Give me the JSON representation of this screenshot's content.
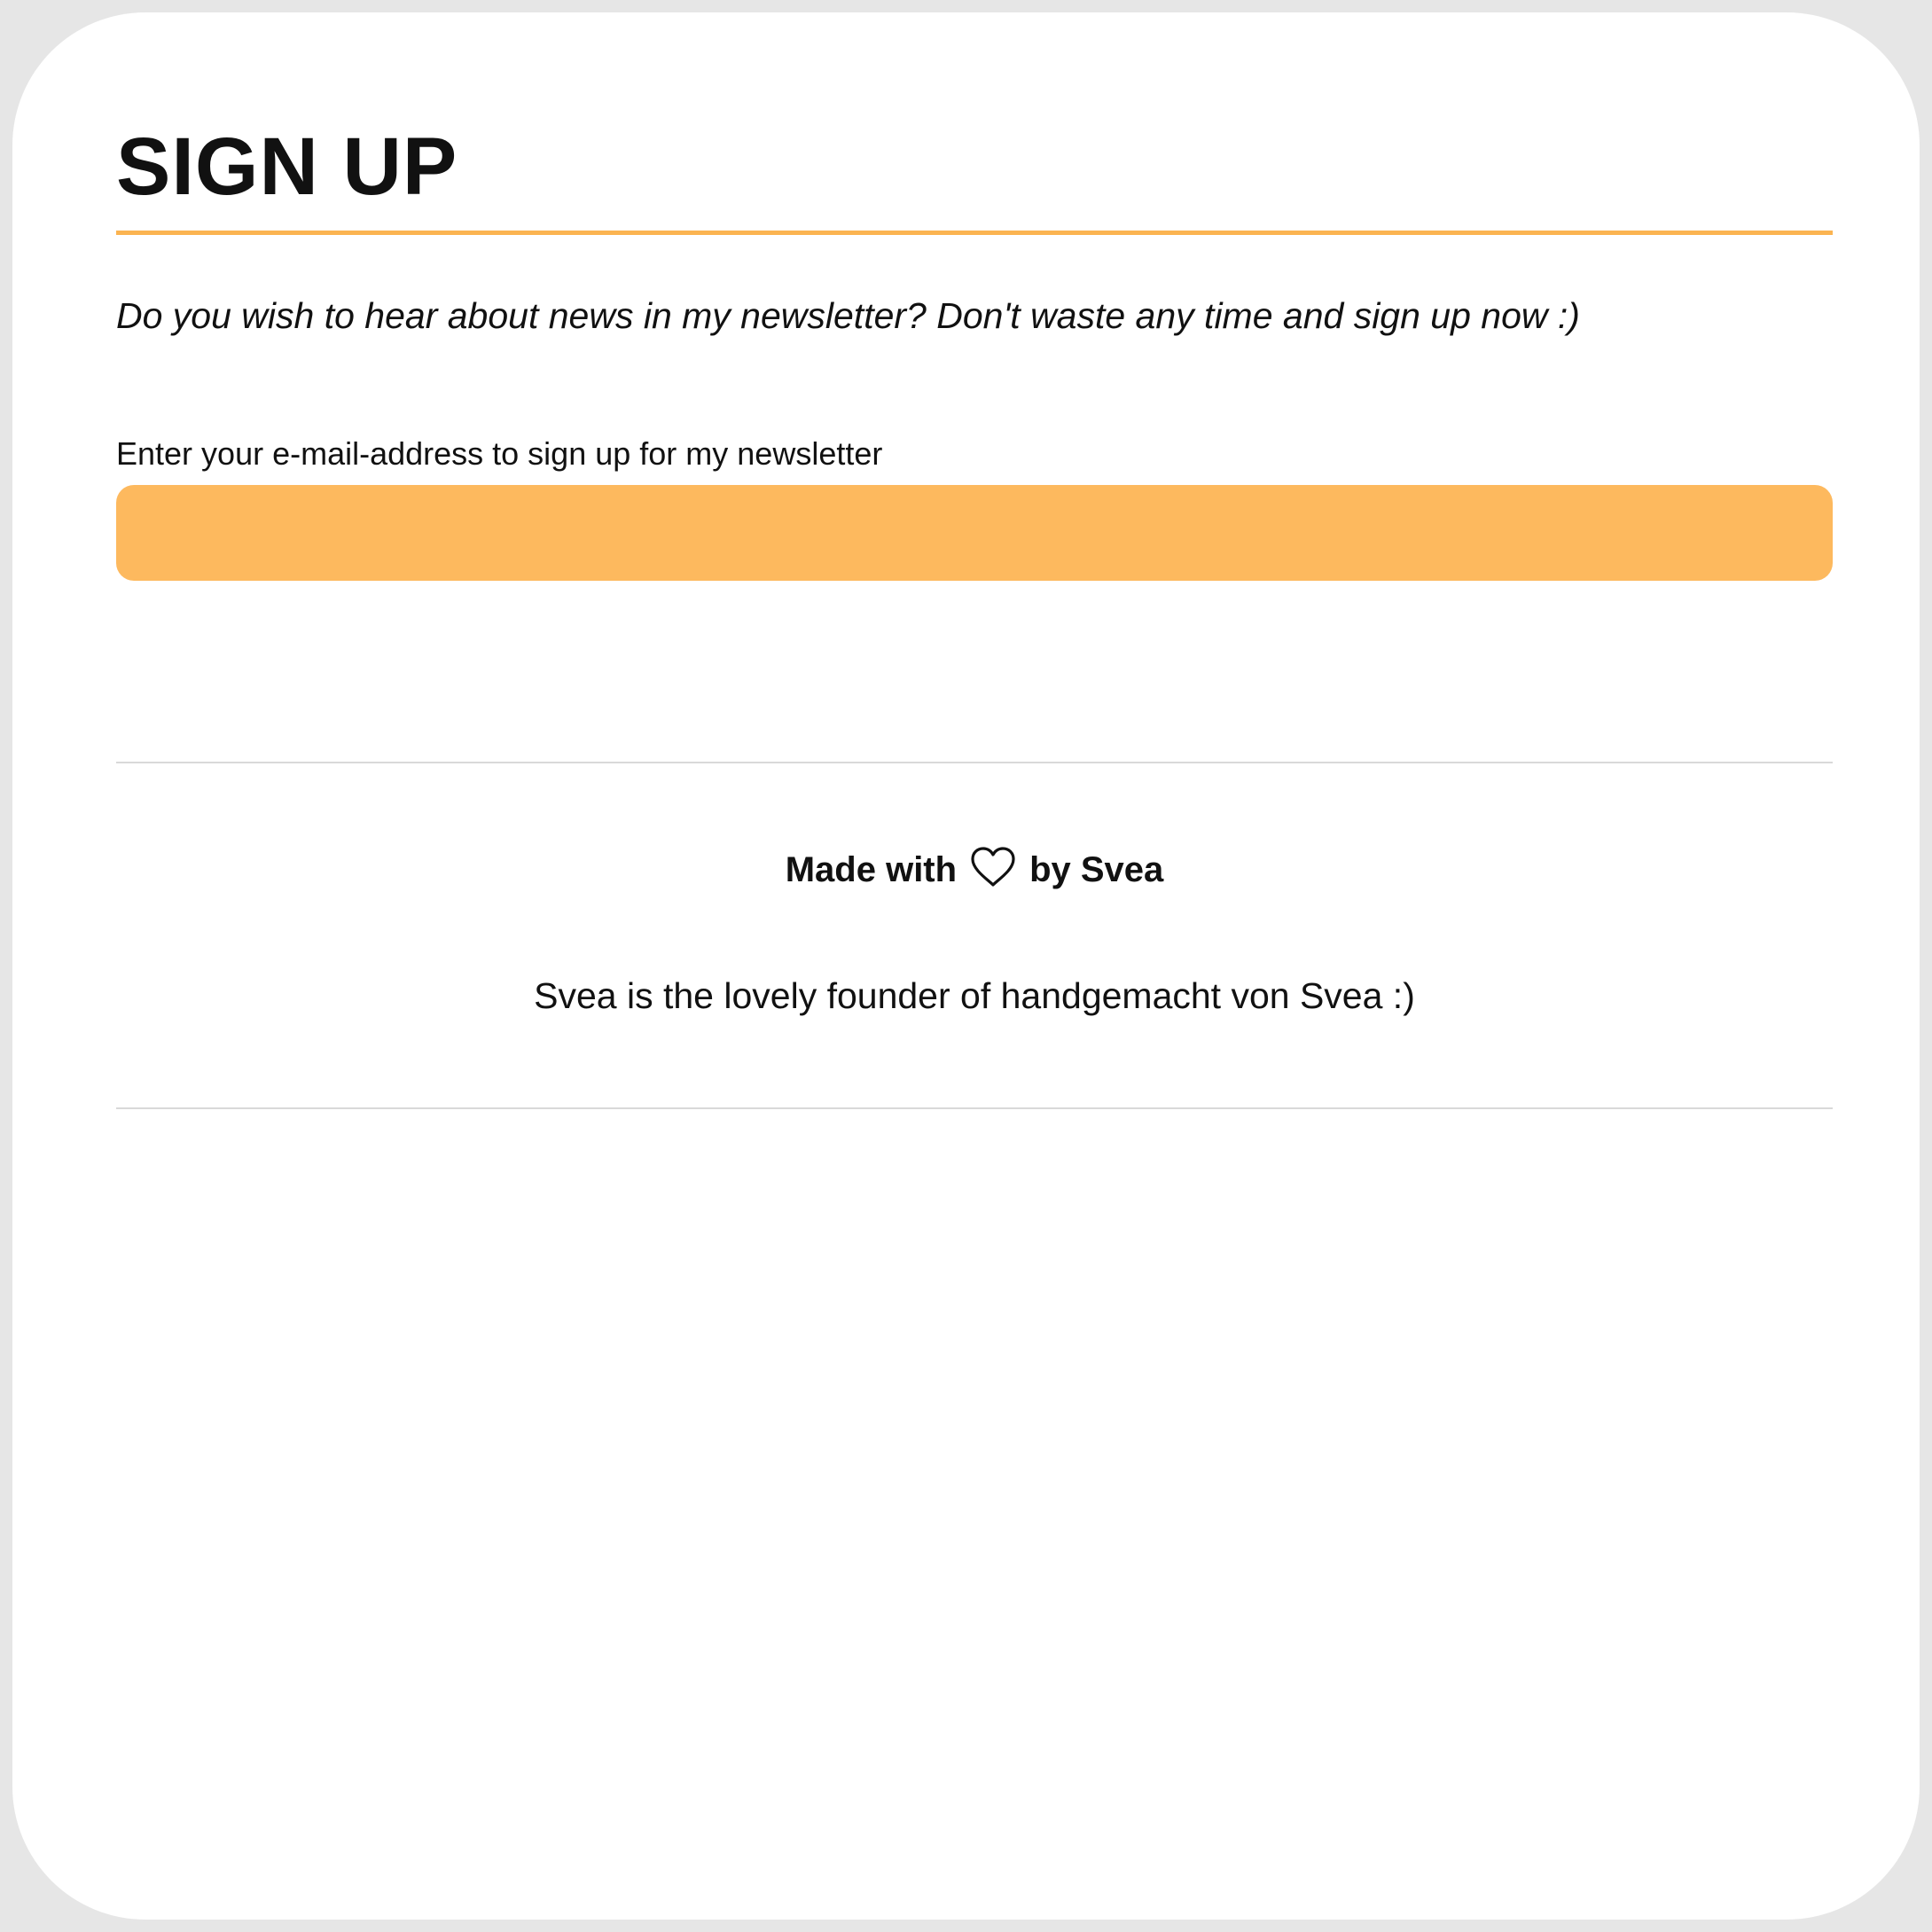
{
  "signup": {
    "title": "SIGN UP",
    "intro": "Do you wish to hear about news in my newsletter? Don't waste any time and sign up now :)",
    "email_label": "Enter your e-mail-address to sign up for my newsletter",
    "email_value": "",
    "email_placeholder": ""
  },
  "footer": {
    "made_with": "Made with",
    "heart_icon": "heart-outline-icon",
    "by_author": "by Svea",
    "founder_text": "Svea is the lovely founder of handgemacht von Svea :)"
  },
  "colors": {
    "accent": "#fbb451",
    "input_background": "#fdb95e",
    "divider": "#d9d9d9",
    "text": "#111111",
    "frame": "#e6e6e6"
  }
}
